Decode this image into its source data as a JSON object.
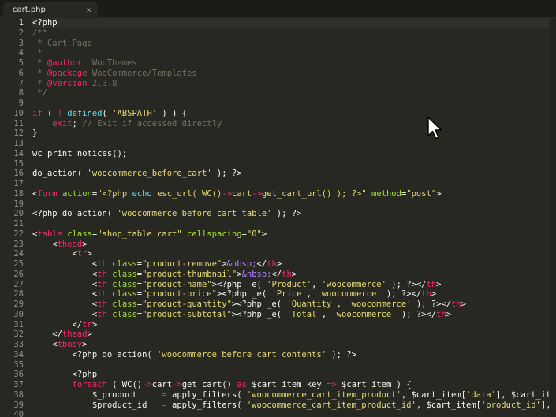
{
  "tab": {
    "label": "cart.php",
    "close_glyph": "×"
  },
  "editor": {
    "active_line": 1,
    "lines": [
      {
        "n": "1",
        "tokens": [
          {
            "t": "<?php",
            "c": "d"
          }
        ]
      },
      {
        "n": "2",
        "tokens": [
          {
            "t": "/**",
            "c": "c"
          }
        ]
      },
      {
        "n": "3",
        "tokens": [
          {
            "t": " * Cart Page",
            "c": "c"
          }
        ]
      },
      {
        "n": "4",
        "tokens": [
          {
            "t": " *",
            "c": "c"
          }
        ]
      },
      {
        "n": "5",
        "tokens": [
          {
            "t": " * ",
            "c": "c"
          },
          {
            "t": "@author",
            "c": "k"
          },
          {
            "t": "  WooThemes",
            "c": "c"
          }
        ]
      },
      {
        "n": "6",
        "tokens": [
          {
            "t": " * ",
            "c": "c"
          },
          {
            "t": "@package",
            "c": "k"
          },
          {
            "t": " WooCommerce/Templates",
            "c": "c"
          }
        ]
      },
      {
        "n": "7",
        "tokens": [
          {
            "t": " * ",
            "c": "c"
          },
          {
            "t": "@version",
            "c": "k"
          },
          {
            "t": " 2.3.8",
            "c": "c"
          }
        ]
      },
      {
        "n": "8",
        "tokens": [
          {
            "t": " */",
            "c": "c"
          }
        ]
      },
      {
        "n": "9",
        "tokens": []
      },
      {
        "n": "10",
        "tokens": [
          {
            "t": "if",
            "c": "k"
          },
          {
            "t": " ( ",
            "c": "d"
          },
          {
            "t": "!",
            "c": "k"
          },
          {
            "t": " ",
            "c": "d"
          },
          {
            "t": "defined",
            "c": "f"
          },
          {
            "t": "( ",
            "c": "d"
          },
          {
            "t": "'ABSPATH'",
            "c": "s"
          },
          {
            "t": " ) ) {",
            "c": "d"
          }
        ]
      },
      {
        "n": "11",
        "tokens": [
          {
            "t": "    ",
            "c": "d"
          },
          {
            "t": "exit",
            "c": "k"
          },
          {
            "t": "; ",
            "c": "d"
          },
          {
            "t": "// Exit if accessed directly",
            "c": "c"
          }
        ]
      },
      {
        "n": "12",
        "tokens": [
          {
            "t": "}",
            "c": "d"
          }
        ]
      },
      {
        "n": "13",
        "tokens": []
      },
      {
        "n": "14",
        "tokens": [
          {
            "t": "wc_print_notices();",
            "c": "d"
          }
        ]
      },
      {
        "n": "15",
        "tokens": []
      },
      {
        "n": "16",
        "tokens": [
          {
            "t": "do_action( ",
            "c": "d"
          },
          {
            "t": "'woocommerce_before_cart'",
            "c": "s"
          },
          {
            "t": " ); ?>",
            "c": "d"
          }
        ]
      },
      {
        "n": "17",
        "tokens": []
      },
      {
        "n": "18",
        "tokens": [
          {
            "t": "<",
            "c": "d"
          },
          {
            "t": "form",
            "c": "k"
          },
          {
            "t": " ",
            "c": "d"
          },
          {
            "t": "action",
            "c": "a"
          },
          {
            "t": "=",
            "c": "d"
          },
          {
            "t": "\"<?php ",
            "c": "s"
          },
          {
            "t": "echo",
            "c": "f"
          },
          {
            "t": " ",
            "c": "d"
          },
          {
            "t": "esc_url(",
            "c": "s"
          },
          {
            "t": " ",
            "c": "d"
          },
          {
            "t": "WC()",
            "c": "s"
          },
          {
            "t": "->",
            "c": "k"
          },
          {
            "t": "cart",
            "c": "s"
          },
          {
            "t": "->",
            "c": "k"
          },
          {
            "t": "get_cart_url() ); ?>\"",
            "c": "s"
          },
          {
            "t": " ",
            "c": "d"
          },
          {
            "t": "method",
            "c": "a"
          },
          {
            "t": "=",
            "c": "d"
          },
          {
            "t": "\"post\"",
            "c": "s"
          },
          {
            "t": ">",
            "c": "d"
          }
        ]
      },
      {
        "n": "19",
        "tokens": []
      },
      {
        "n": "20",
        "tokens": [
          {
            "t": "<?php do_action( ",
            "c": "d"
          },
          {
            "t": "'woocommerce_before_cart_table'",
            "c": "s"
          },
          {
            "t": " ); ?>",
            "c": "d"
          }
        ]
      },
      {
        "n": "21",
        "tokens": []
      },
      {
        "n": "22",
        "tokens": [
          {
            "t": "<",
            "c": "d"
          },
          {
            "t": "table",
            "c": "k"
          },
          {
            "t": " ",
            "c": "d"
          },
          {
            "t": "class",
            "c": "a"
          },
          {
            "t": "=",
            "c": "d"
          },
          {
            "t": "\"shop_table cart\"",
            "c": "s"
          },
          {
            "t": " ",
            "c": "d"
          },
          {
            "t": "cellspacing",
            "c": "a"
          },
          {
            "t": "=",
            "c": "d"
          },
          {
            "t": "\"0\"",
            "c": "s"
          },
          {
            "t": ">",
            "c": "d"
          }
        ]
      },
      {
        "n": "23",
        "tokens": [
          {
            "t": "    <",
            "c": "d"
          },
          {
            "t": "thead",
            "c": "k"
          },
          {
            "t": ">",
            "c": "d"
          }
        ]
      },
      {
        "n": "24",
        "tokens": [
          {
            "t": "        <",
            "c": "d"
          },
          {
            "t": "tr",
            "c": "k"
          },
          {
            "t": ">",
            "c": "d"
          }
        ]
      },
      {
        "n": "25",
        "tokens": [
          {
            "t": "            <",
            "c": "d"
          },
          {
            "t": "th",
            "c": "k"
          },
          {
            "t": " ",
            "c": "d"
          },
          {
            "t": "class",
            "c": "a"
          },
          {
            "t": "=",
            "c": "d"
          },
          {
            "t": "\"product-remove\"",
            "c": "s"
          },
          {
            "t": ">",
            "c": "d"
          },
          {
            "t": "&nbsp;",
            "c": "x"
          },
          {
            "t": "</",
            "c": "d"
          },
          {
            "t": "th",
            "c": "k"
          },
          {
            "t": ">",
            "c": "d"
          }
        ]
      },
      {
        "n": "26",
        "tokens": [
          {
            "t": "            <",
            "c": "d"
          },
          {
            "t": "th",
            "c": "k"
          },
          {
            "t": " ",
            "c": "d"
          },
          {
            "t": "class",
            "c": "a"
          },
          {
            "t": "=",
            "c": "d"
          },
          {
            "t": "\"product-thumbnail\"",
            "c": "s"
          },
          {
            "t": ">",
            "c": "d"
          },
          {
            "t": "&nbsp;",
            "c": "x"
          },
          {
            "t": "</",
            "c": "d"
          },
          {
            "t": "th",
            "c": "k"
          },
          {
            "t": ">",
            "c": "d"
          }
        ]
      },
      {
        "n": "27",
        "tokens": [
          {
            "t": "            <",
            "c": "d"
          },
          {
            "t": "th",
            "c": "k"
          },
          {
            "t": " ",
            "c": "d"
          },
          {
            "t": "class",
            "c": "a"
          },
          {
            "t": "=",
            "c": "d"
          },
          {
            "t": "\"product-name\"",
            "c": "s"
          },
          {
            "t": "><?php _e( ",
            "c": "d"
          },
          {
            "t": "'Product'",
            "c": "s"
          },
          {
            "t": ", ",
            "c": "d"
          },
          {
            "t": "'woocommerce'",
            "c": "s"
          },
          {
            "t": " ); ?></",
            "c": "d"
          },
          {
            "t": "th",
            "c": "k"
          },
          {
            "t": ">",
            "c": "d"
          }
        ]
      },
      {
        "n": "28",
        "tokens": [
          {
            "t": "            <",
            "c": "d"
          },
          {
            "t": "th",
            "c": "k"
          },
          {
            "t": " ",
            "c": "d"
          },
          {
            "t": "class",
            "c": "a"
          },
          {
            "t": "=",
            "c": "d"
          },
          {
            "t": "\"product-price\"",
            "c": "s"
          },
          {
            "t": "><?php _e( ",
            "c": "d"
          },
          {
            "t": "'Price'",
            "c": "s"
          },
          {
            "t": ", ",
            "c": "d"
          },
          {
            "t": "'woocommerce'",
            "c": "s"
          },
          {
            "t": " ); ?></",
            "c": "d"
          },
          {
            "t": "th",
            "c": "k"
          },
          {
            "t": ">",
            "c": "d"
          }
        ]
      },
      {
        "n": "29",
        "tokens": [
          {
            "t": "            <",
            "c": "d"
          },
          {
            "t": "th",
            "c": "k"
          },
          {
            "t": " ",
            "c": "d"
          },
          {
            "t": "class",
            "c": "a"
          },
          {
            "t": "=",
            "c": "d"
          },
          {
            "t": "\"product-quantity\"",
            "c": "s"
          },
          {
            "t": "><?php _e( ",
            "c": "d"
          },
          {
            "t": "'Quantity'",
            "c": "s"
          },
          {
            "t": ", ",
            "c": "d"
          },
          {
            "t": "'woocommerce'",
            "c": "s"
          },
          {
            "t": " ); ?></",
            "c": "d"
          },
          {
            "t": "th",
            "c": "k"
          },
          {
            "t": ">",
            "c": "d"
          }
        ]
      },
      {
        "n": "30",
        "tokens": [
          {
            "t": "            <",
            "c": "d"
          },
          {
            "t": "th",
            "c": "k"
          },
          {
            "t": " ",
            "c": "d"
          },
          {
            "t": "class",
            "c": "a"
          },
          {
            "t": "=",
            "c": "d"
          },
          {
            "t": "\"product-subtotal\"",
            "c": "s"
          },
          {
            "t": "><?php _e( ",
            "c": "d"
          },
          {
            "t": "'Total'",
            "c": "s"
          },
          {
            "t": ", ",
            "c": "d"
          },
          {
            "t": "'woocommerce'",
            "c": "s"
          },
          {
            "t": " ); ?></",
            "c": "d"
          },
          {
            "t": "th",
            "c": "k"
          },
          {
            "t": ">",
            "c": "d"
          }
        ]
      },
      {
        "n": "31",
        "tokens": [
          {
            "t": "        </",
            "c": "d"
          },
          {
            "t": "tr",
            "c": "k"
          },
          {
            "t": ">",
            "c": "d"
          }
        ]
      },
      {
        "n": "32",
        "tokens": [
          {
            "t": "    </",
            "c": "d"
          },
          {
            "t": "thead",
            "c": "k"
          },
          {
            "t": ">",
            "c": "d"
          }
        ]
      },
      {
        "n": "33",
        "tokens": [
          {
            "t": "    <",
            "c": "d"
          },
          {
            "t": "tbody",
            "c": "k"
          },
          {
            "t": ">",
            "c": "d"
          }
        ]
      },
      {
        "n": "34",
        "tokens": [
          {
            "t": "        <?php do_action( ",
            "c": "d"
          },
          {
            "t": "'woocommerce_before_cart_contents'",
            "c": "s"
          },
          {
            "t": " ); ?>",
            "c": "d"
          }
        ]
      },
      {
        "n": "35",
        "tokens": []
      },
      {
        "n": "36",
        "tokens": [
          {
            "t": "        <?php",
            "c": "d"
          }
        ]
      },
      {
        "n": "37",
        "tokens": [
          {
            "t": "        ",
            "c": "d"
          },
          {
            "t": "foreach",
            "c": "k"
          },
          {
            "t": " ( WC()",
            "c": "d"
          },
          {
            "t": "->",
            "c": "k"
          },
          {
            "t": "cart",
            "c": "d"
          },
          {
            "t": "->",
            "c": "k"
          },
          {
            "t": "get_cart() ",
            "c": "d"
          },
          {
            "t": "as",
            "c": "k"
          },
          {
            "t": " $cart_item_key ",
            "c": "d"
          },
          {
            "t": "=>",
            "c": "k"
          },
          {
            "t": " $cart_item ) {",
            "c": "d"
          }
        ]
      },
      {
        "n": "38",
        "tokens": [
          {
            "t": "            $_product     ",
            "c": "d"
          },
          {
            "t": "=",
            "c": "k"
          },
          {
            "t": " apply_filters( ",
            "c": "d"
          },
          {
            "t": "'woocommerce_cart_item_product'",
            "c": "s"
          },
          {
            "t": ", $cart_item[",
            "c": "d"
          },
          {
            "t": "'data'",
            "c": "s"
          },
          {
            "t": "], $cart_item, $c",
            "c": "d"
          }
        ]
      },
      {
        "n": "39",
        "tokens": [
          {
            "t": "            $product_id   ",
            "c": "d"
          },
          {
            "t": "=",
            "c": "k"
          },
          {
            "t": " apply_filters( ",
            "c": "d"
          },
          {
            "t": "'woocommerce_cart_item_product_id'",
            "c": "s"
          },
          {
            "t": ", $cart_item[",
            "c": "d"
          },
          {
            "t": "'product_id'",
            "c": "s"
          },
          {
            "t": "], $cart",
            "c": "d"
          }
        ]
      },
      {
        "n": "40",
        "tokens": []
      }
    ]
  },
  "colors": {
    "background": "#272822",
    "default": "#f8f8f2",
    "comment": "#75715e",
    "keyword": "#f92672",
    "string": "#e6db74",
    "function": "#66d9ef",
    "attribute": "#a6e22e",
    "constant": "#ae81ff"
  },
  "cursor": {
    "icon": "mouse-pointer-icon"
  }
}
